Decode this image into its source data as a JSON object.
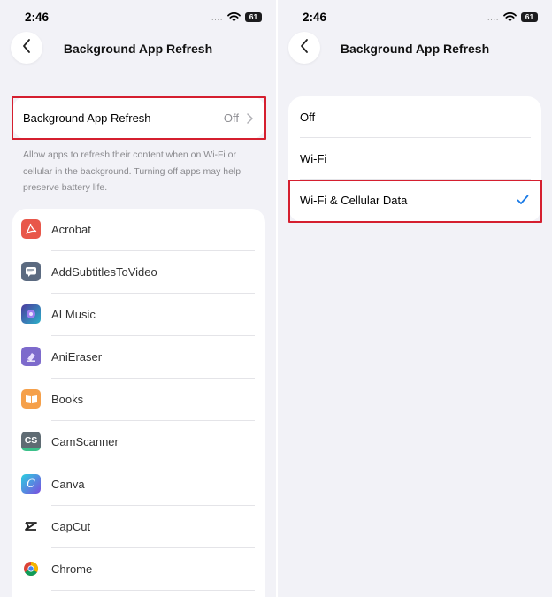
{
  "left": {
    "status": {
      "time": "2:46",
      "dots": "....",
      "battery": "61"
    },
    "nav": {
      "title": "Background App Refresh"
    },
    "setting_row": {
      "label": "Background App Refresh",
      "value": "Off"
    },
    "footer": "Allow apps to refresh their content when on Wi-Fi or cellular in the background. Turning off apps may help preserve battery life.",
    "apps": [
      {
        "name": "Acrobat"
      },
      {
        "name": "AddSubtitlesToVideo"
      },
      {
        "name": "AI Music"
      },
      {
        "name": "AniEraser"
      },
      {
        "name": "Books"
      },
      {
        "name": "CamScanner",
        "icon_text": "CS"
      },
      {
        "name": "Canva",
        "icon_text": "C"
      },
      {
        "name": "CapCut"
      },
      {
        "name": "Chrome"
      }
    ]
  },
  "right": {
    "status": {
      "time": "2:46",
      "dots": "....",
      "battery": "61"
    },
    "nav": {
      "title": "Background App Refresh"
    },
    "options": [
      {
        "label": "Off"
      },
      {
        "label": "Wi-Fi"
      },
      {
        "label": "Wi-Fi & Cellular Data",
        "selected": true
      }
    ]
  },
  "colors": {
    "highlight": "#d51f2f",
    "checkmark": "#1a7ae6",
    "background": "#f2f2f7"
  }
}
